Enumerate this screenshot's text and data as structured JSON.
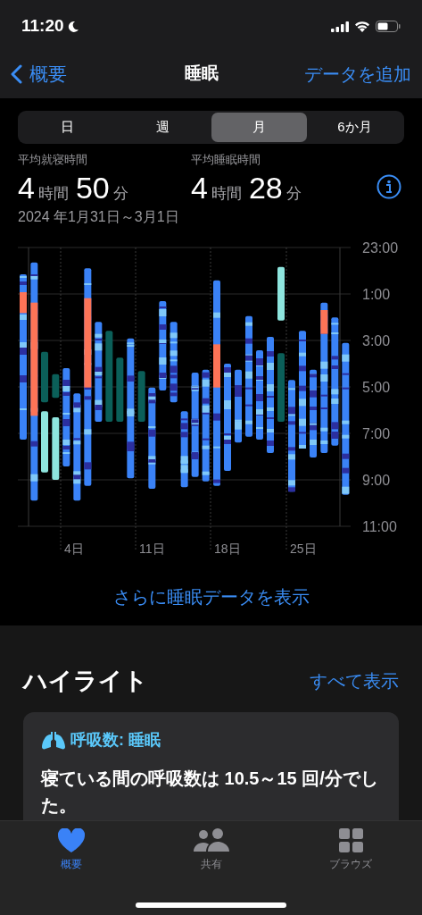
{
  "status_bar": {
    "time": "11:20"
  },
  "nav": {
    "back": "概要",
    "title": "睡眠",
    "action": "データを追加"
  },
  "segments": [
    {
      "label": "日",
      "selected": false
    },
    {
      "label": "週",
      "selected": false
    },
    {
      "label": "月",
      "selected": true
    },
    {
      "label": "6か月",
      "selected": false
    }
  ],
  "stats": [
    {
      "label": "平均就寝時間",
      "hours": "4",
      "hours_unit": "時間",
      "minutes": "50",
      "minutes_unit": "分"
    },
    {
      "label": "平均睡眠時間",
      "hours": "4",
      "hours_unit": "時間",
      "minutes": "28",
      "minutes_unit": "分"
    }
  ],
  "date_range": "2024 年1月31日～3月1日",
  "chart": {
    "y_labels": [
      "23:00",
      "1:00",
      "3:00",
      "5:00",
      "7:00",
      "9:00",
      "11:00"
    ],
    "x_labels": [
      "4日",
      "11日",
      "18日",
      "25日"
    ]
  },
  "show_more": "さらに睡眠データを表示",
  "highlights": {
    "title": "ハイライト",
    "see_all": "すべて表示",
    "card": {
      "title": "呼吸数: 睡眠",
      "text": "寝ている間の呼吸数は 10.5～15 回/分でした。"
    }
  },
  "tab_bar": [
    {
      "label": "概要",
      "selected": true
    },
    {
      "label": "共有",
      "selected": false
    },
    {
      "label": "ブラウズ",
      "selected": false
    }
  ]
}
